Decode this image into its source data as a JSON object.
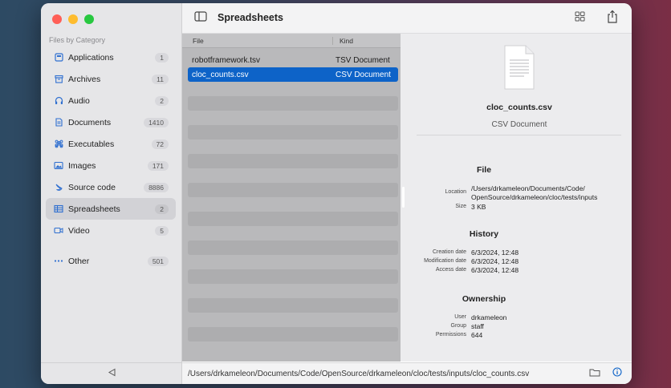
{
  "toolbar": {
    "title": "Spreadsheets"
  },
  "sidebar": {
    "heading": "Files by Category",
    "items": [
      {
        "label": "Applications",
        "count": "1",
        "icon": "app-icon"
      },
      {
        "label": "Archives",
        "count": "11",
        "icon": "archive-icon"
      },
      {
        "label": "Audio",
        "count": "2",
        "icon": "headphones-icon"
      },
      {
        "label": "Documents",
        "count": "1410",
        "icon": "document-icon"
      },
      {
        "label": "Executables",
        "count": "72",
        "icon": "command-icon"
      },
      {
        "label": "Images",
        "count": "171",
        "icon": "photo-icon"
      },
      {
        "label": "Source code",
        "count": "8886",
        "icon": "swift-icon"
      },
      {
        "label": "Spreadsheets",
        "count": "2",
        "icon": "table-icon"
      },
      {
        "label": "Video",
        "count": "5",
        "icon": "video-icon"
      }
    ],
    "other": {
      "label": "Other",
      "count": "501",
      "icon": "ellipsis-icon"
    }
  },
  "list": {
    "columns": {
      "file": "File",
      "kind": "Kind"
    },
    "rows": [
      {
        "file": "robotframework.tsv",
        "kind": "TSV Document"
      },
      {
        "file": "cloc_counts.csv",
        "kind": "CSV Document"
      }
    ]
  },
  "detail": {
    "name": "cloc_counts.csv",
    "kind": "CSV Document",
    "file_section": {
      "title": "File",
      "location_label": "Location",
      "location_line1": "/Users/drkameleon/Documents/Code/",
      "location_line2": "OpenSource/drkameleon/cloc/tests/inputs",
      "size_label": "Size",
      "size": "3 KB"
    },
    "history_section": {
      "title": "History",
      "creation_label": "Creation date",
      "creation": "6/3/2024, 12:48",
      "modification_label": "Modification date",
      "modification": "6/3/2024, 12:48",
      "access_label": "Access date",
      "access": "6/3/2024, 12:48"
    },
    "ownership_section": {
      "title": "Ownership",
      "user_label": "User",
      "user": "drkameleon",
      "group_label": "Group",
      "group": "staff",
      "permissions_label": "Permissions",
      "permissions": "644"
    }
  },
  "statusbar": {
    "path": "/Users/drkameleon/Documents/Code/OpenSource/drkameleon/cloc/tests/inputs/cloc_counts.csv"
  },
  "colors": {
    "accent": "#0d63c8",
    "selected_sidebar": "#d2d2d6"
  }
}
